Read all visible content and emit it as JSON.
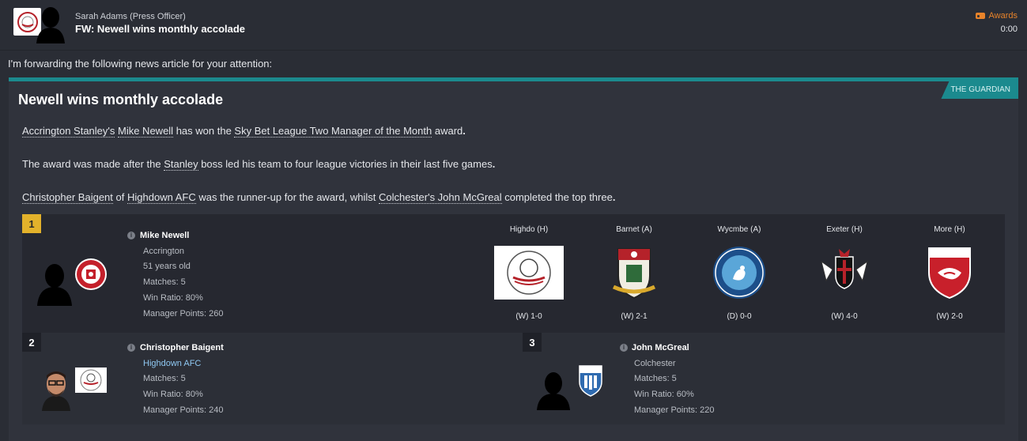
{
  "header": {
    "sender": "Sarah Adams  (Press Officer)",
    "subject": "FW: Newell wins monthly accolade",
    "category": "Awards",
    "time": "0:00"
  },
  "intro": "I'm forwarding the following news article for your attention:",
  "article": {
    "source": "THE GUARDIAN",
    "headline": "Newell wins monthly accolade",
    "p1": {
      "club": "Accrington Stanley's",
      "manager": "Mike Newell",
      "mid": " has won the ",
      "award": "Sky Bet League Two Manager of the Month",
      "tail": " award",
      "end": "."
    },
    "p2": {
      "pre": "The award was made after the ",
      "club": "Stanley",
      "tail": " boss led his team to four league victories in their last five games",
      "end": "."
    },
    "p3": {
      "runner": "Christopher Baigent",
      "of": " of ",
      "runner_club": "Highdown AFC",
      "mid": " was the runner-up for the award, whilst ",
      "third": "Colchester's John McGreal",
      "tail": " completed the top three",
      "end": "."
    }
  },
  "winner": {
    "rank": "1",
    "name": "Mike Newell",
    "club": "Accrington",
    "age": "51 years old",
    "matches": "Matches: 5",
    "win_ratio": "Win Ratio: 80%",
    "points": "Manager Points: 260"
  },
  "matches": [
    {
      "opponent": "Highdo (H)",
      "result": "(W) 1-0",
      "crest": "highdown-crest"
    },
    {
      "opponent": "Barnet (A)",
      "result": "(W) 2-1",
      "crest": "barnet-crest"
    },
    {
      "opponent": "Wycmbe (A)",
      "result": "(D) 0-0",
      "crest": "wycombe-crest"
    },
    {
      "opponent": "Exeter (H)",
      "result": "(W) 4-0",
      "crest": "exeter-crest"
    },
    {
      "opponent": "More (H)",
      "result": "(W) 2-0",
      "crest": "morecambe-crest"
    }
  ],
  "second": {
    "rank": "2",
    "name": "Christopher Baigent",
    "club": "Highdown AFC",
    "matches": "Matches: 5",
    "win_ratio": "Win Ratio: 80%",
    "points": "Manager Points: 240"
  },
  "third": {
    "rank": "3",
    "name": "John McGreal",
    "club": "Colchester",
    "matches": "Matches: 5",
    "win_ratio": "Win Ratio: 60%",
    "points": "Manager Points: 220"
  },
  "colors": {
    "accent": "#1b8a8e",
    "gold": "#e3b22b",
    "award": "#e8832a",
    "link": "#8fc8f2"
  }
}
